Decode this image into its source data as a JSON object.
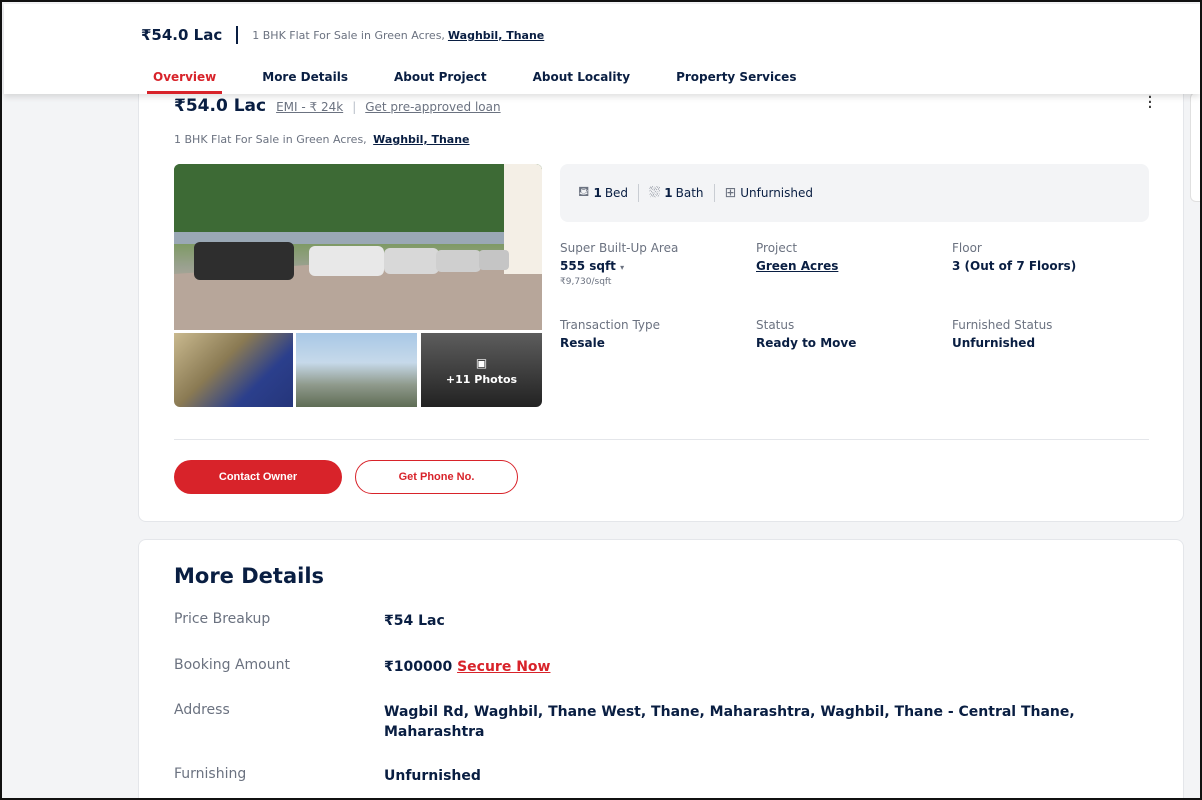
{
  "sticky_header": {
    "price": "₹54.0 Lac",
    "title": "1 BHK Flat For Sale in Green Acres,",
    "locality": "Waghbil, Thane",
    "tabs": [
      "Overview",
      "More Details",
      "About Project",
      "About Locality",
      "Property Services"
    ]
  },
  "listing": {
    "price": "₹54.0 Lac",
    "emi": "EMI - ₹ 24k",
    "separator": "|",
    "loan_link": "Get pre-approved loan",
    "subtitle": "1 BHK Flat For Sale in Green Acres,",
    "subtitle_locality": "Waghbil, Thane",
    "photos_more": "+11 Photos",
    "amenities": {
      "bed_count": "1",
      "bed_label": "Bed",
      "bath_count": "1",
      "bath_label": "Bath",
      "furnishing": "Unfurnished"
    },
    "details": {
      "area_label": "Super Built-Up Area",
      "area_value": "555 sqft",
      "area_rate": "₹9,730/sqft",
      "project_label": "Project",
      "project_value": "Green Acres",
      "floor_label": "Floor",
      "floor_value": "3 (Out of 7 Floors)",
      "transaction_label": "Transaction Type",
      "transaction_value": "Resale",
      "status_label": "Status",
      "status_value": "Ready to Move",
      "furnished_label": "Furnished Status",
      "furnished_value": "Unfurnished"
    },
    "buttons": {
      "contact": "Contact Owner",
      "phone": "Get Phone No."
    }
  },
  "more_details": {
    "title": "More Details",
    "price_breakup_label": "Price Breakup",
    "price_breakup_value": "₹54 Lac",
    "booking_label": "Booking Amount",
    "booking_value": "₹100000",
    "booking_link": "Secure Now",
    "address_label": "Address",
    "address_value": "Wagbil Rd, Waghbil, Thane West, Thane, Maharashtra, Waghbil, Thane - Central Thane, Maharashtra",
    "furnishing_label": "Furnishing",
    "furnishing_value": "Unfurnished"
  },
  "colors": {
    "accent": "#d8232a",
    "text_dark": "#091e42",
    "text_muted": "#6b7280"
  }
}
